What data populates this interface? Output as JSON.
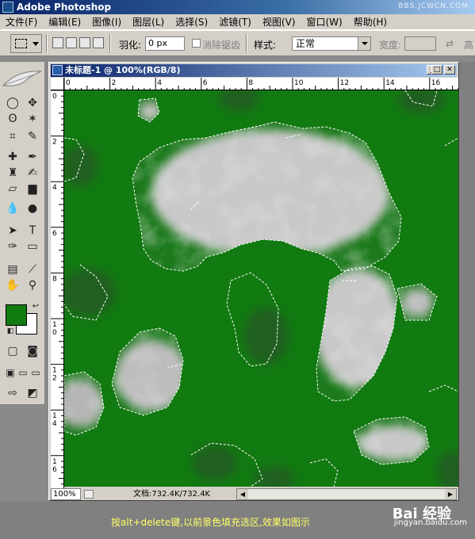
{
  "app": {
    "title": "Adobe Photoshop",
    "watermark": "BBS.JCWCN.COM"
  },
  "menu": [
    {
      "label": "文件(F)"
    },
    {
      "label": "编辑(E)"
    },
    {
      "label": "图像(I)"
    },
    {
      "label": "图层(L)"
    },
    {
      "label": "选择(S)"
    },
    {
      "label": "滤镜(T)"
    },
    {
      "label": "视图(V)"
    },
    {
      "label": "窗口(W)"
    },
    {
      "label": "帮助(H)"
    }
  ],
  "options": {
    "feather_label": "羽化:",
    "feather_value": "0 px",
    "antialias_label": "消除锯齿",
    "style_label": "样式:",
    "style_value": "正常",
    "width_label": "宽度:",
    "height_label": "高"
  },
  "colors": {
    "foreground": "#117a11",
    "background": "#ffffff"
  },
  "document": {
    "title": "未标题-1 @ 100%(RGB/8)",
    "ruler_h": [
      "0",
      "2",
      "4",
      "6",
      "8",
      "10",
      "12",
      "14",
      "16"
    ],
    "ruler_v": [
      "0",
      "2",
      "4",
      "6",
      "8",
      "1\n0",
      "1\n2",
      "1\n4",
      "1\n6"
    ],
    "zoom": "100%",
    "doc_info": "文档:732.4K/732.4K"
  },
  "caption": "按alt+delete键,以前景色填充选区,效果如图示",
  "brand": {
    "name": "Bai 经验",
    "url": "jingyan.baidu.com"
  }
}
